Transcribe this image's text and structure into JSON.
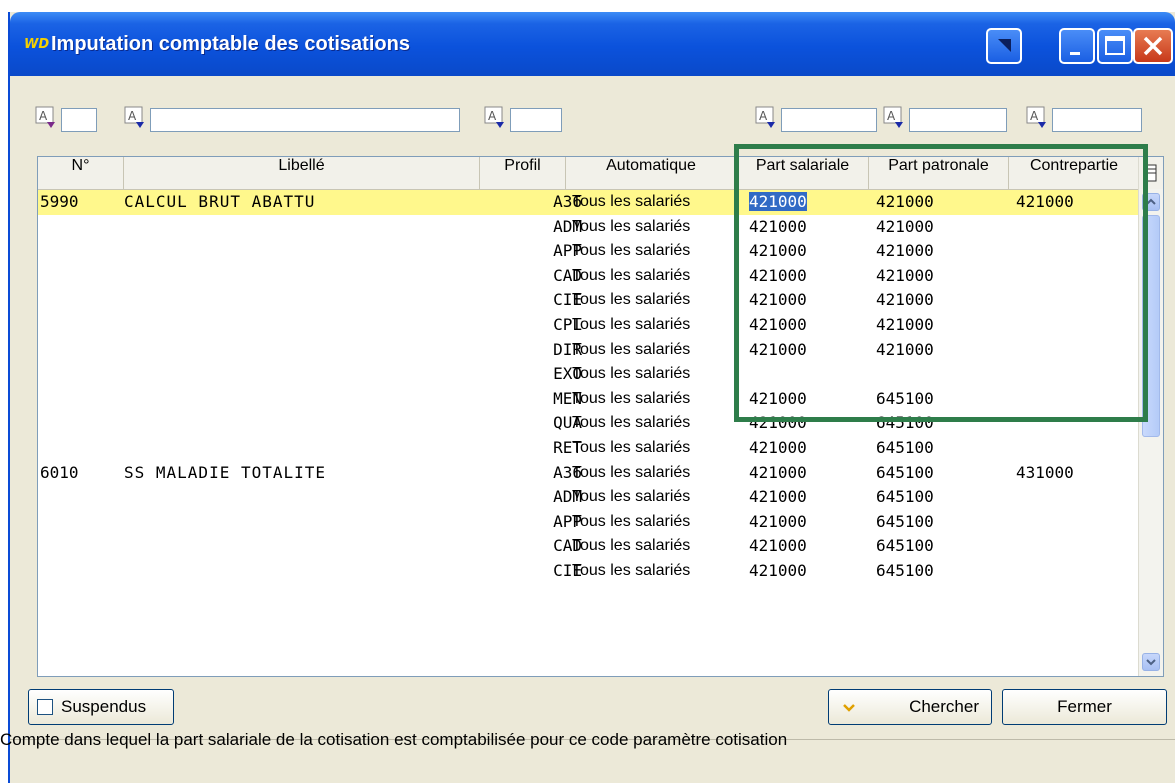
{
  "window": {
    "logo": "WD",
    "title": "Imputation comptable des cotisations"
  },
  "columns": {
    "num": "N°",
    "libelle": "Libellé",
    "profil": "Profil",
    "automatique": "Automatique",
    "part_salariale": "Part salariale",
    "part_patronale": "Part patronale",
    "contrepartie": "Contrepartie"
  },
  "rows": [
    {
      "num": "5990",
      "libelle": "CALCUL BRUT ABATTU",
      "profil": "A36",
      "auto": "Tous les salariés",
      "sal": "421000",
      "pat": "421000",
      "con": "421000"
    },
    {
      "num": "",
      "libelle": "",
      "profil": "ADM",
      "auto": "Tous les salariés",
      "sal": "421000",
      "pat": "421000",
      "con": ""
    },
    {
      "num": "",
      "libelle": "",
      "profil": "APP",
      "auto": "Tous les salariés",
      "sal": "421000",
      "pat": "421000",
      "con": ""
    },
    {
      "num": "",
      "libelle": "",
      "profil": "CAD",
      "auto": "Tous les salariés",
      "sal": "421000",
      "pat": "421000",
      "con": ""
    },
    {
      "num": "",
      "libelle": "",
      "profil": "CIE",
      "auto": "Tous les salariés",
      "sal": "421000",
      "pat": "421000",
      "con": ""
    },
    {
      "num": "",
      "libelle": "",
      "profil": "CPL",
      "auto": "Tous les salariés",
      "sal": "421000",
      "pat": "421000",
      "con": ""
    },
    {
      "num": "",
      "libelle": "",
      "profil": "DIR",
      "auto": "Tous les salariés",
      "sal": "421000",
      "pat": "421000",
      "con": ""
    },
    {
      "num": "",
      "libelle": "",
      "profil": "EXO",
      "auto": "Tous les salariés",
      "sal": "",
      "pat": "",
      "con": ""
    },
    {
      "num": "",
      "libelle": "",
      "profil": "MEN",
      "auto": "Tous les salariés",
      "sal": "421000",
      "pat": "645100",
      "con": ""
    },
    {
      "num": "",
      "libelle": "",
      "profil": "QUA",
      "auto": "Tous les salariés",
      "sal": "421000",
      "pat": "645100",
      "con": ""
    },
    {
      "num": "",
      "libelle": "",
      "profil": "RET",
      "auto": "Tous les salariés",
      "sal": "421000",
      "pat": "645100",
      "con": ""
    },
    {
      "num": "6010",
      "libelle": "SS MALADIE TOTALITE",
      "profil": "A36",
      "auto": "Tous les salariés",
      "sal": "421000",
      "pat": "645100",
      "con": "431000"
    },
    {
      "num": "",
      "libelle": "",
      "profil": "ADM",
      "auto": "Tous les salariés",
      "sal": "421000",
      "pat": "645100",
      "con": ""
    },
    {
      "num": "",
      "libelle": "",
      "profil": "APP",
      "auto": "Tous les salariés",
      "sal": "421000",
      "pat": "645100",
      "con": ""
    },
    {
      "num": "",
      "libelle": "",
      "profil": "CAD",
      "auto": "Tous les salariés",
      "sal": "421000",
      "pat": "645100",
      "con": ""
    },
    {
      "num": "",
      "libelle": "",
      "profil": "CIE",
      "auto": "Tous les salariés",
      "sal": "421000",
      "pat": "645100",
      "con": ""
    }
  ],
  "buttons": {
    "suspendus": "Suspendus",
    "chercher": "Chercher",
    "fermer": "Fermer"
  },
  "status": "Compte dans lequel la part salariale de la cotisation est comptabilisée pour ce code paramètre cotisation",
  "colors": {
    "selected_row": "#fff88c",
    "highlight_box": "#2e7d4a",
    "title_bar": "#0a4bd6"
  }
}
